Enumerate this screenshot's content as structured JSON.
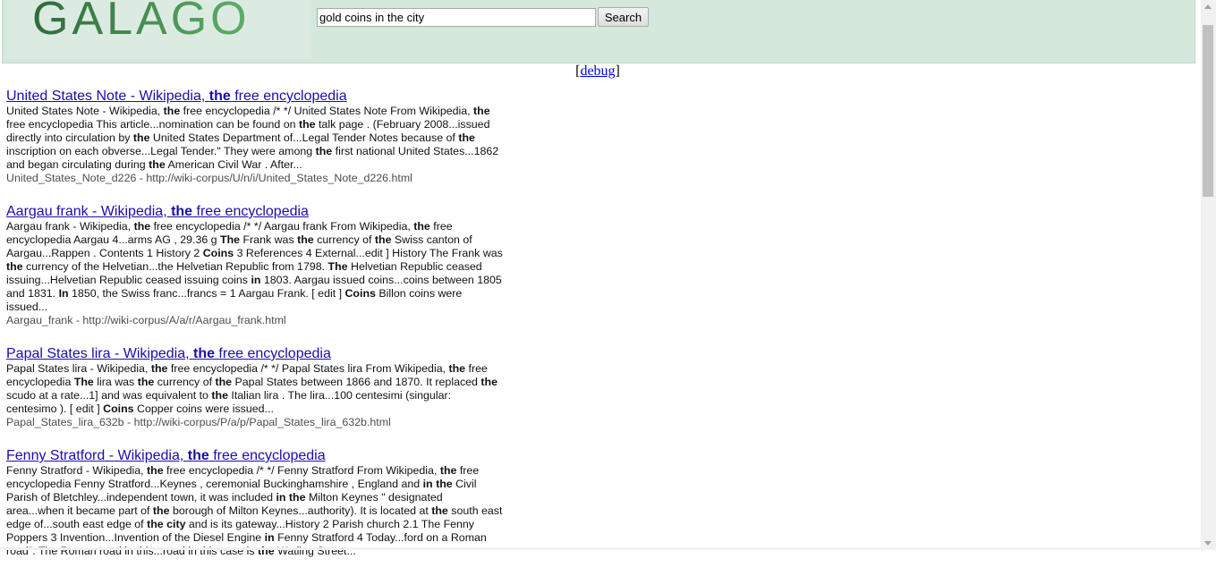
{
  "header": {
    "logo_text": "GALAGO",
    "search": {
      "value": "gold coins in the city",
      "button_label": "Search"
    }
  },
  "debug": {
    "open": "[",
    "link": "debug",
    "close": "]"
  },
  "results": [
    {
      "title": "United States Note - Wikipedia, <b>the</b> free encyclopedia",
      "snippet": "United States Note - Wikipedia, <b>the</b> free encyclopedia /* */ United States Note From Wikipedia, <b>the</b> free encyclopedia This article...nomination can be found on <b>the</b> talk page . (February 2008...issued directly into circulation by <b>the</b> United States Department of...Legal Tender Notes because of <b>the</b> inscription on each obverse...Legal Tender.\" They were among <b>the</b> first national United States...1862 and began circulating during <b>the</b> American Civil War . After...",
      "url": "United_States_Note_d226 - http://wiki-corpus/U/n/i/United_States_Note_d226.html"
    },
    {
      "title": "Aargau frank - Wikipedia, <b>the</b> free encyclopedia",
      "snippet": "Aargau frank - Wikipedia, <b>the</b> free encyclopedia /* */ Aargau frank From Wikipedia, <b>the</b> free encyclopedia Aargau 4...arms AG , 29.36 g <b>The</b> Frank was <b>the</b> currency of <b>the</b> Swiss canton of Aargau...Rappen . Contents 1 History 2 <b>Coins</b> 3 References 4 External...edit ] History The Frank was <b>the</b> currency of the Helvetian...the Helvetian Republic from 1798. <b>The</b> Helvetian Republic ceased issuing...Helvetian Republic ceased issuing coins <b>in</b> 1803. Aargau issued coins...coins between 1805 and 1831. <b>In</b> 1850, the Swiss franc...francs = 1 Aargau Frank. [ edit ] <b>Coins</b> Billon coins were issued...",
      "url": "Aargau_frank - http://wiki-corpus/A/a/r/Aargau_frank.html"
    },
    {
      "title": "Papal States lira - Wikipedia, <b>the</b> free encyclopedia",
      "snippet": "Papal States lira - Wikipedia, <b>the</b> free encyclopedia /* */ Papal States lira From Wikipedia, <b>the</b> free encyclopedia <b>The</b> lira was <b>the</b> currency of <b>the</b> Papal States between 1866 and 1870. It replaced <b>the</b> scudo at a rate...1] and was equivalent to <b>the</b> Italian lira . The lira...100 centesimi (singular: centesimo ). [ edit ] <b>Coins</b> Copper coins were issued...",
      "url": "Papal_States_lira_632b - http://wiki-corpus/P/a/p/Papal_States_lira_632b.html"
    },
    {
      "title": "Fenny Stratford - Wikipedia, <b>the</b> free encyclopedia",
      "snippet": "Fenny Stratford - Wikipedia, <b>the</b> free encyclopedia /* */ Fenny Stratford From Wikipedia, <b>the</b> free encyclopedia Fenny Stratford...Keynes , ceremonial Buckinghamshire , England and <b>in the</b> Civil Parish of Bletchley...independent town, it was included <b>in the</b> Milton Keynes \" designated area...when it became part of <b>the</b> borough of Milton Keynes...authority). It is located at <b>the</b> south east edge of...south east edge of <b>the city</b> and is its gateway...History 2 Parish church 2.1 The Fenny Poppers 3 Invention...Invention of the Diesel Engine <b>in</b> Fenny Stratford 4 Today...ford on a Roman road\". The Roman road in this...road in this case is <b>the</b> Watling Street...",
      "url": ""
    }
  ],
  "colors": {
    "header_bg": "#d4e8dc",
    "logo_green": "#2e6e3e",
    "link": "#1a0dab",
    "url": "#4d4d4d"
  }
}
